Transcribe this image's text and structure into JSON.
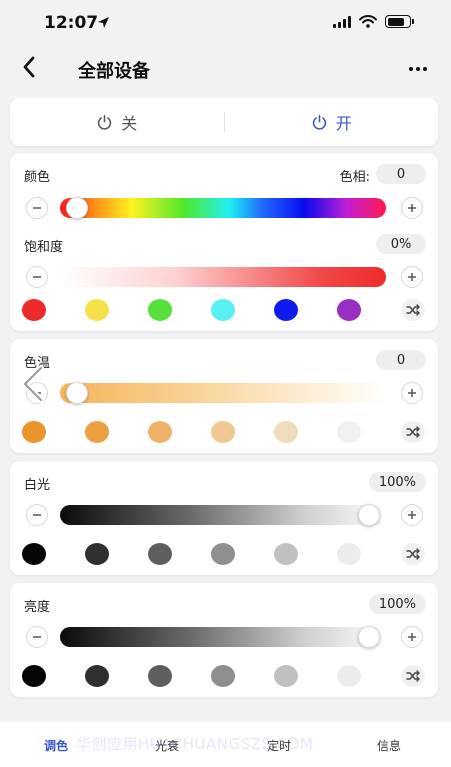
{
  "status_bar": {
    "time": "12:07"
  },
  "nav": {
    "title": "全部设备"
  },
  "power": {
    "off_label": "关",
    "on_label": "开"
  },
  "color_card": {
    "label": "颜色",
    "hue_label": "色相:",
    "hue_value": "0",
    "hue_position": 0.02,
    "saturation_label": "饱和度",
    "saturation_value": "0%",
    "swatches": [
      "#ee2b2b",
      "#f6e14a",
      "#55e13a",
      "#59f0f4",
      "#0d1bf0",
      "#9a2ec2"
    ]
  },
  "temp_card": {
    "label": "色温",
    "value": "0",
    "position": 0.02,
    "swatches": [
      "#e9952c",
      "#eaa043",
      "#ecb265",
      "#efc790",
      "#f0dcbd",
      "#f0f0f2"
    ]
  },
  "white_card": {
    "label": "白光",
    "value": "100%",
    "position": 0.98,
    "swatches": [
      "#050505",
      "#303030",
      "#5e5e5e",
      "#8f8f8f",
      "#c0c0c0",
      "#ececee"
    ]
  },
  "brightness_card": {
    "label": "亮度",
    "value": "100%",
    "position": 0.98,
    "swatches": [
      "#050505",
      "#303030",
      "#5e5e5e",
      "#8f8f8f",
      "#c0c0c0",
      "#ececee"
    ]
  },
  "tabs": [
    {
      "label": "调色",
      "active": true
    },
    {
      "label": "光衰",
      "active": false
    },
    {
      "label": "定时",
      "active": false
    },
    {
      "label": "信息",
      "active": false
    }
  ],
  "watermark": "华创应用HUACHUANGSZS.COM",
  "colors": {
    "accent": "#3a56c9"
  }
}
